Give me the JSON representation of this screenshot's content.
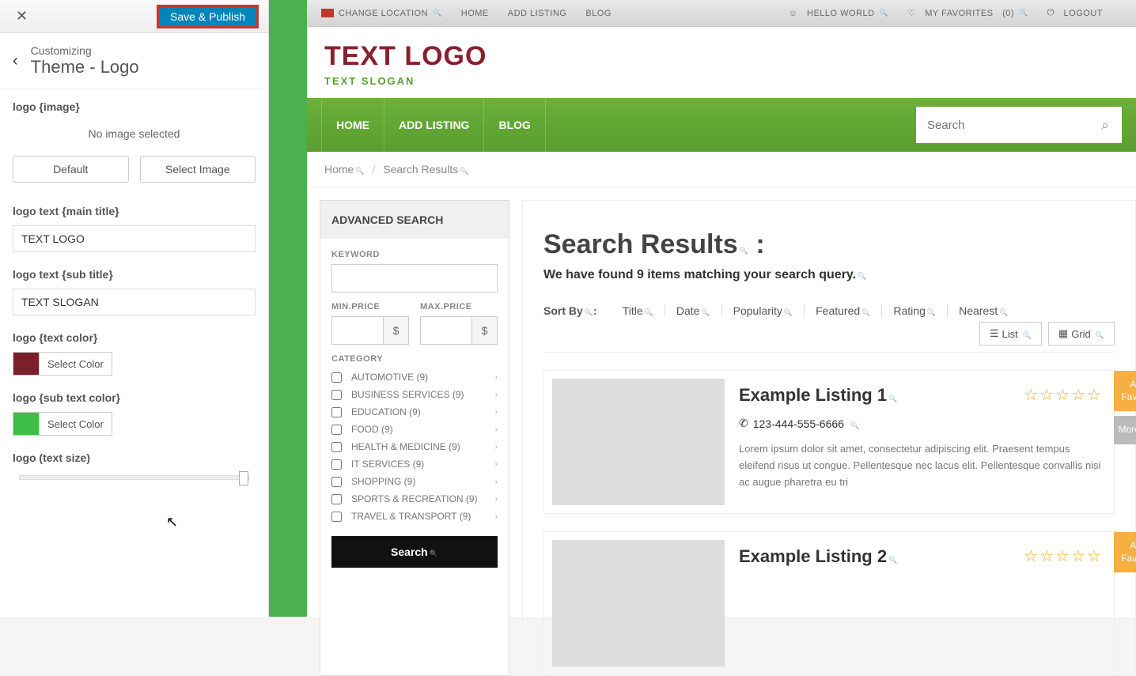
{
  "customizer": {
    "close": "✕",
    "save_publish": "Save & Publish",
    "back": "‹",
    "customizing": "Customizing",
    "section": "Theme - Logo",
    "logo_image_label": "logo {image}",
    "no_image": "No image selected",
    "default_btn": "Default",
    "select_image_btn": "Select Image",
    "main_title_label": "logo text {main title}",
    "main_title_value": "TEXT LOGO",
    "sub_title_label": "logo text {sub title}",
    "sub_title_value": "TEXT SLOGAN",
    "text_color_label": "logo {text color}",
    "text_color": "#7b1f2b",
    "sub_text_color_label": "logo {sub text color}",
    "sub_text_color": "#3bbf4a",
    "select_color_btn": "Select Color",
    "text_size_label": "logo (text size)"
  },
  "topbar": {
    "change_location": "CHANGE LOCATION",
    "home": "HOME",
    "add_listing": "ADD LISTING",
    "blog": "BLOG",
    "hello": "HELLO WORLD",
    "favorites": "MY FAVORITES",
    "fav_count": "(0)",
    "logout": "LOGOUT"
  },
  "brand": {
    "logo": "TEXT LOGO",
    "slogan": "TEXT SLOGAN",
    "logo_color": "#8a1f2f",
    "slogan_color": "#5a9e2f"
  },
  "nav": {
    "home": "HOME",
    "add_listing": "ADD LISTING",
    "blog": "BLOG",
    "search_placeholder": "Search"
  },
  "breadcrumb": {
    "home": "Home",
    "current": "Search Results"
  },
  "adv_search": {
    "title": "ADVANCED SEARCH",
    "keyword": "KEYWORD",
    "min_price": "MIN.PRICE",
    "max_price": "MAX.PRICE",
    "currency": "$",
    "category": "CATEGORY",
    "categories": [
      "AUTOMOTIVE (9)",
      "BUSINESS SERVICES (9)",
      "EDUCATION (9)",
      "FOOD (9)",
      "HEALTH & MEDICINE (9)",
      "IT SERVICES (9)",
      "SHOPPING (9)",
      "SPORTS & RECREATION (9)",
      "TRAVEL & TRANSPORT (9)"
    ],
    "search_btn": "Search"
  },
  "results": {
    "title": "Search Results",
    "colon": " :",
    "subtitle": "We have found 9 items matching your search query.",
    "sort_by": "Sort By",
    "sort_colon": ":",
    "sorts": [
      "Title",
      "Date",
      "Popularity",
      "Featured",
      "Rating",
      "Nearest"
    ],
    "list_view": "List",
    "grid_view": "Grid"
  },
  "listings": [
    {
      "title": "Example Listing 1",
      "phone": "123-444-555-6666",
      "desc": "Lorem ipsum dolor sit amet, consectetur adipiscing elit. Praesent tempus eleifend risus ut congue. Pellentesque nec lacus elit. Pellentesque convallis nisi ac augue pharetra eu tri",
      "add_fav": "Add Favorite",
      "more_info": "More Info"
    },
    {
      "title": "Example Listing 2",
      "add_fav": "Add Favorite"
    }
  ]
}
